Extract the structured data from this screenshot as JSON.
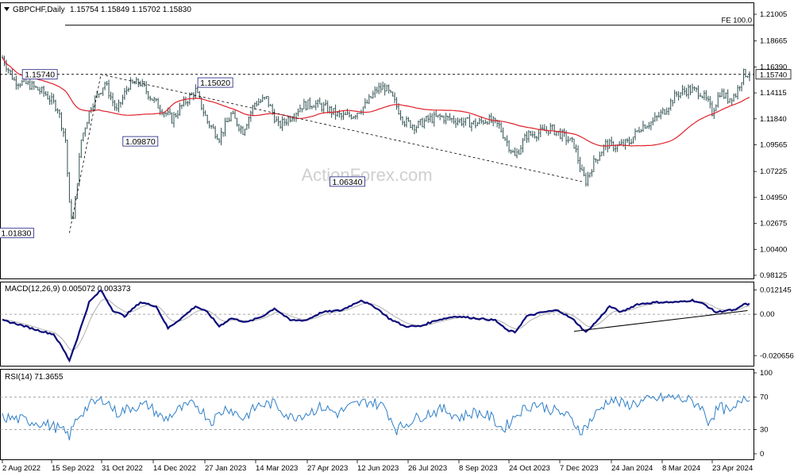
{
  "header": {
    "symbol_label": "GBPCHF,Daily",
    "ohlc": "1.15754 1.15849 1.15702 1.15830",
    "fe_label": "FE 100.0",
    "watermark": "ActionForex.com",
    "last_price": "1.15740"
  },
  "colors": {
    "candles": "#2f4f4f",
    "sma": "#e0202a",
    "macd": "#0b0b7a",
    "signal": "#b0b0b0",
    "rsi": "#2f7fc7",
    "trend": "#000000",
    "price_tag_bg": "#ffffff"
  },
  "chart_data": [
    {
      "type": "candlestick",
      "panel": "price",
      "y_ticks": [
        "1.21005",
        "1.18665",
        "1.16390",
        "1.14115",
        "1.11840",
        "1.09565",
        "1.07225",
        "1.04950",
        "1.02675",
        "1.00400",
        "0.98125"
      ],
      "ylim": [
        0.98125,
        1.21005
      ],
      "annotations": [
        "1.15740",
        "1.09870",
        "1.15020",
        "1.01830",
        "1.06340"
      ],
      "fe_level": 1.2005,
      "horizontal_level": 1.1574,
      "anchors": [
        {
          "i": 0,
          "v": 1.172
        },
        {
          "i": 6,
          "v": 1.152
        },
        {
          "i": 14,
          "v": 1.148
        },
        {
          "i": 22,
          "v": 1.14
        },
        {
          "i": 28,
          "v": 1.128
        },
        {
          "i": 32,
          "v": 1.1
        },
        {
          "i": 34,
          "v": 1.042
        },
        {
          "i": 36,
          "v": 1.03
        },
        {
          "i": 40,
          "v": 1.1
        },
        {
          "i": 45,
          "v": 1.13
        },
        {
          "i": 52,
          "v": 1.15
        },
        {
          "i": 58,
          "v": 1.125
        },
        {
          "i": 64,
          "v": 1.148
        },
        {
          "i": 70,
          "v": 1.15
        },
        {
          "i": 75,
          "v": 1.138
        },
        {
          "i": 80,
          "v": 1.128
        },
        {
          "i": 86,
          "v": 1.118
        },
        {
          "i": 92,
          "v": 1.132
        },
        {
          "i": 98,
          "v": 1.143
        },
        {
          "i": 104,
          "v": 1.116
        },
        {
          "i": 110,
          "v": 1.102
        },
        {
          "i": 116,
          "v": 1.122
        },
        {
          "i": 122,
          "v": 1.108
        },
        {
          "i": 128,
          "v": 1.132
        },
        {
          "i": 134,
          "v": 1.136
        },
        {
          "i": 140,
          "v": 1.112
        },
        {
          "i": 146,
          "v": 1.12
        },
        {
          "i": 152,
          "v": 1.13
        },
        {
          "i": 158,
          "v": 1.132
        },
        {
          "i": 164,
          "v": 1.128
        },
        {
          "i": 172,
          "v": 1.12
        },
        {
          "i": 178,
          "v": 1.122
        },
        {
          "i": 184,
          "v": 1.13
        },
        {
          "i": 190,
          "v": 1.144
        },
        {
          "i": 194,
          "v": 1.146
        },
        {
          "i": 198,
          "v": 1.136
        },
        {
          "i": 204,
          "v": 1.116
        },
        {
          "i": 210,
          "v": 1.112
        },
        {
          "i": 216,
          "v": 1.118
        },
        {
          "i": 222,
          "v": 1.12
        },
        {
          "i": 228,
          "v": 1.118
        },
        {
          "i": 234,
          "v": 1.116
        },
        {
          "i": 240,
          "v": 1.114
        },
        {
          "i": 246,
          "v": 1.118
        },
        {
          "i": 252,
          "v": 1.112
        },
        {
          "i": 256,
          "v": 1.098
        },
        {
          "i": 260,
          "v": 1.085
        },
        {
          "i": 266,
          "v": 1.104
        },
        {
          "i": 272,
          "v": 1.106
        },
        {
          "i": 278,
          "v": 1.11
        },
        {
          "i": 284,
          "v": 1.104
        },
        {
          "i": 290,
          "v": 1.096
        },
        {
          "i": 294,
          "v": 1.07
        },
        {
          "i": 296,
          "v": 1.064
        },
        {
          "i": 300,
          "v": 1.08
        },
        {
          "i": 306,
          "v": 1.096
        },
        {
          "i": 312,
          "v": 1.094
        },
        {
          "i": 318,
          "v": 1.098
        },
        {
          "i": 324,
          "v": 1.112
        },
        {
          "i": 330,
          "v": 1.116
        },
        {
          "i": 336,
          "v": 1.126
        },
        {
          "i": 342,
          "v": 1.14
        },
        {
          "i": 348,
          "v": 1.144
        },
        {
          "i": 354,
          "v": 1.142
        },
        {
          "i": 358,
          "v": 1.132
        },
        {
          "i": 360,
          "v": 1.124
        },
        {
          "i": 364,
          "v": 1.142
        },
        {
          "i": 368,
          "v": 1.136
        },
        {
          "i": 372,
          "v": 1.14
        },
        {
          "i": 376,
          "v": 1.158
        }
      ]
    },
    {
      "type": "line",
      "panel": "macd",
      "title": "MACD(12,26,9) 0.005072 0.003373",
      "y_ticks": [
        "0.012145",
        "0.00",
        "-0.020656"
      ],
      "ylim": [
        -0.0245,
        0.0135
      ],
      "series": [
        {
          "name": "MACD",
          "anchors": [
            {
              "i": 0,
              "v": -0.003
            },
            {
              "i": 8,
              "v": -0.005
            },
            {
              "i": 18,
              "v": -0.008
            },
            {
              "i": 26,
              "v": -0.01
            },
            {
              "i": 30,
              "v": -0.016
            },
            {
              "i": 34,
              "v": -0.023
            },
            {
              "i": 38,
              "v": -0.012
            },
            {
              "i": 44,
              "v": 0.006
            },
            {
              "i": 50,
              "v": 0.012
            },
            {
              "i": 56,
              "v": 0.002
            },
            {
              "i": 62,
              "v": -0.001
            },
            {
              "i": 70,
              "v": 0.006
            },
            {
              "i": 78,
              "v": 0.004
            },
            {
              "i": 84,
              "v": -0.007
            },
            {
              "i": 92,
              "v": -0.001
            },
            {
              "i": 98,
              "v": 0.004
            },
            {
              "i": 104,
              "v": 0.001
            },
            {
              "i": 110,
              "v": -0.006
            },
            {
              "i": 116,
              "v": -0.002
            },
            {
              "i": 124,
              "v": -0.004
            },
            {
              "i": 132,
              "v": -0.001
            },
            {
              "i": 138,
              "v": 0.003
            },
            {
              "i": 146,
              "v": -0.003
            },
            {
              "i": 154,
              "v": -0.003
            },
            {
              "i": 162,
              "v": 0.001
            },
            {
              "i": 172,
              "v": 0.002
            },
            {
              "i": 182,
              "v": 0.007
            },
            {
              "i": 190,
              "v": 0.003
            },
            {
              "i": 196,
              "v": -0.002
            },
            {
              "i": 204,
              "v": -0.006
            },
            {
              "i": 212,
              "v": -0.006
            },
            {
              "i": 220,
              "v": -0.003
            },
            {
              "i": 230,
              "v": -0.001
            },
            {
              "i": 240,
              "v": -0.002
            },
            {
              "i": 250,
              "v": -0.003
            },
            {
              "i": 256,
              "v": -0.008
            },
            {
              "i": 260,
              "v": -0.009
            },
            {
              "i": 266,
              "v": -0.001
            },
            {
              "i": 274,
              "v": 0.001
            },
            {
              "i": 282,
              "v": 0.002
            },
            {
              "i": 290,
              "v": -0.003
            },
            {
              "i": 296,
              "v": -0.009
            },
            {
              "i": 302,
              "v": -0.003
            },
            {
              "i": 308,
              "v": 0.004
            },
            {
              "i": 314,
              "v": 0.001
            },
            {
              "i": 322,
              "v": 0.005
            },
            {
              "i": 332,
              "v": 0.006
            },
            {
              "i": 342,
              "v": 0.006
            },
            {
              "i": 350,
              "v": 0.007
            },
            {
              "i": 356,
              "v": 0.005
            },
            {
              "i": 362,
              "v": 0.001
            },
            {
              "i": 368,
              "v": 0.002
            },
            {
              "i": 372,
              "v": 0.002
            },
            {
              "i": 376,
              "v": 0.005
            }
          ]
        }
      ],
      "trendline": [
        {
          "i": 290,
          "v": -0.0085
        },
        {
          "i": 378,
          "v": 0.0018
        }
      ]
    },
    {
      "type": "line",
      "panel": "rsi",
      "title": "RSI(14) 71.3655",
      "y_ticks": [
        "100",
        "70",
        "30",
        "0"
      ],
      "ylim": [
        0,
        100
      ],
      "series": [
        {
          "name": "RSI",
          "anchors": [
            {
              "i": 0,
              "v": 45
            },
            {
              "i": 10,
              "v": 42
            },
            {
              "i": 20,
              "v": 38
            },
            {
              "i": 28,
              "v": 32
            },
            {
              "i": 34,
              "v": 22
            },
            {
              "i": 38,
              "v": 45
            },
            {
              "i": 44,
              "v": 60
            },
            {
              "i": 52,
              "v": 68
            },
            {
              "i": 58,
              "v": 50
            },
            {
              "i": 66,
              "v": 58
            },
            {
              "i": 74,
              "v": 60
            },
            {
              "i": 82,
              "v": 42
            },
            {
              "i": 90,
              "v": 55
            },
            {
              "i": 98,
              "v": 62
            },
            {
              "i": 106,
              "v": 40
            },
            {
              "i": 114,
              "v": 58
            },
            {
              "i": 122,
              "v": 44
            },
            {
              "i": 130,
              "v": 60
            },
            {
              "i": 138,
              "v": 62
            },
            {
              "i": 146,
              "v": 45
            },
            {
              "i": 154,
              "v": 50
            },
            {
              "i": 162,
              "v": 58
            },
            {
              "i": 170,
              "v": 50
            },
            {
              "i": 178,
              "v": 60
            },
            {
              "i": 186,
              "v": 65
            },
            {
              "i": 194,
              "v": 58
            },
            {
              "i": 200,
              "v": 30
            },
            {
              "i": 208,
              "v": 42
            },
            {
              "i": 216,
              "v": 50
            },
            {
              "i": 224,
              "v": 55
            },
            {
              "i": 232,
              "v": 45
            },
            {
              "i": 240,
              "v": 52
            },
            {
              "i": 248,
              "v": 45
            },
            {
              "i": 254,
              "v": 30
            },
            {
              "i": 262,
              "v": 52
            },
            {
              "i": 270,
              "v": 62
            },
            {
              "i": 278,
              "v": 55
            },
            {
              "i": 286,
              "v": 48
            },
            {
              "i": 294,
              "v": 28
            },
            {
              "i": 302,
              "v": 52
            },
            {
              "i": 308,
              "v": 68
            },
            {
              "i": 316,
              "v": 60
            },
            {
              "i": 324,
              "v": 64
            },
            {
              "i": 332,
              "v": 68
            },
            {
              "i": 340,
              "v": 70
            },
            {
              "i": 348,
              "v": 66
            },
            {
              "i": 354,
              "v": 60
            },
            {
              "i": 358,
              "v": 40
            },
            {
              "i": 364,
              "v": 58
            },
            {
              "i": 370,
              "v": 50
            },
            {
              "i": 376,
              "v": 71
            }
          ]
        }
      ],
      "levels": [
        70,
        30
      ]
    }
  ],
  "x_labels": [
    "2 Aug 2022",
    "15 Sep 2022",
    "31 Oct 2022",
    "14 Dec 2022",
    "27 Jan 2023",
    "14 Mar 2023",
    "27 Apr 2023",
    "12 Jun 2023",
    "26 Jul 2023",
    "8 Sep 2023",
    "24 Oct 2023",
    "7 Dec 2023",
    "24 Jan 2024",
    "8 Mar 2024",
    "23 Apr 2024"
  ]
}
